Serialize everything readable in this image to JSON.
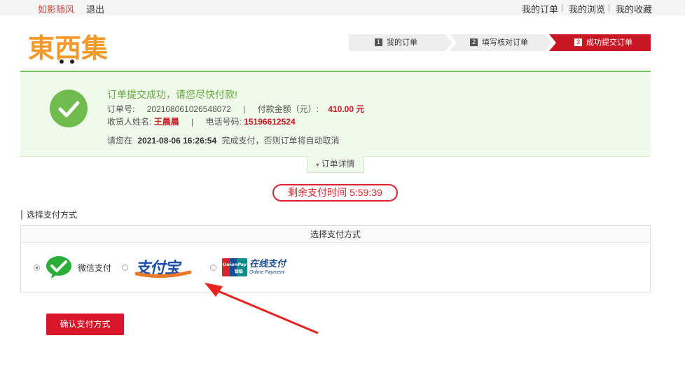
{
  "topbar": {
    "user_name": "如影随风",
    "logout": "退出",
    "my_orders": "我的订单",
    "my_browse": "我的浏览",
    "my_favorites": "我的收藏",
    "sep": "|"
  },
  "logo": {
    "text": "東西集"
  },
  "steps": [
    {
      "num": "1",
      "label": "我的订单"
    },
    {
      "num": "2",
      "label": "填写核对订单"
    },
    {
      "num": "3",
      "label": "成功提交订单"
    }
  ],
  "success": {
    "title": "订单提交成功，请您尽快付款!",
    "order_no_label": "订单号:",
    "order_no": "202108061026548072",
    "amount_label": "付款金额（元）:",
    "amount": "410.00 元",
    "receiver_label": "收货人姓名:",
    "receiver": "王晨晨",
    "phone_label": "电话号码:",
    "phone": "15196612524",
    "deadline_prefix": "请您在",
    "deadline": "2021-08-06 16:26:54",
    "deadline_suffix": "完成支付，否则订单将自动取消",
    "sep": "|"
  },
  "details_toggle": "订单详情",
  "timer": "剩余支付时间 5:59:39",
  "pay_section_title": "选择支付方式",
  "pay_box_header": "选择支付方式",
  "pay_options": {
    "wechat": "微信支付",
    "alipay": "支付宝",
    "unionpay_cn": "在线支付",
    "unionpay_en": "Online Payment",
    "unionpay_brand": "UnionPay",
    "unionpay_brand_cn": "银联"
  },
  "confirm_button": "确认支付方式",
  "colors": {
    "brand_red": "#c81623",
    "success_green": "#6fbb4d",
    "logo_orange": "#f29b2c"
  }
}
